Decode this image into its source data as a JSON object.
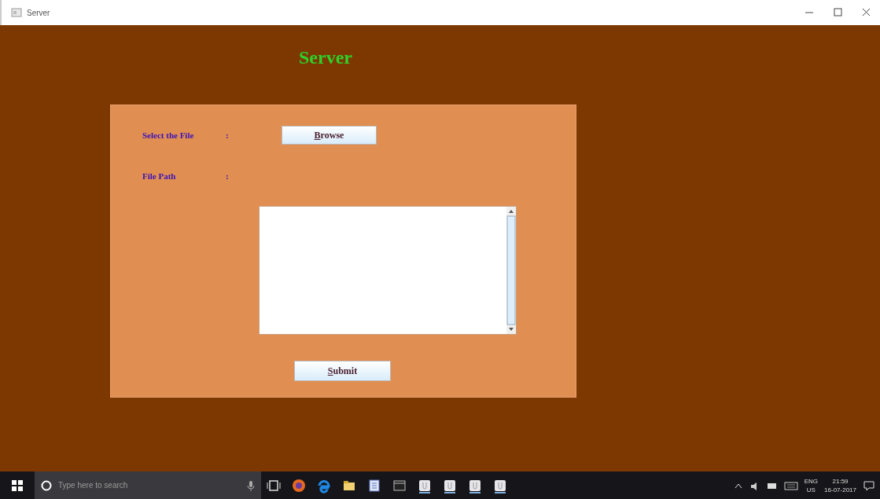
{
  "window": {
    "title": "Server"
  },
  "heading": "Server",
  "form": {
    "fields": [
      {
        "label": "Select the File",
        "separator": ":",
        "kind": "button",
        "button": "Browse"
      },
      {
        "label": "File Path",
        "separator": ":",
        "kind": "textarea"
      }
    ],
    "submit": "Submit"
  },
  "taskbar": {
    "search": {
      "placeholder": "Type here to search"
    },
    "language": "ENG",
    "region": "US",
    "time": "21:59",
    "date": "16-07-2017"
  }
}
